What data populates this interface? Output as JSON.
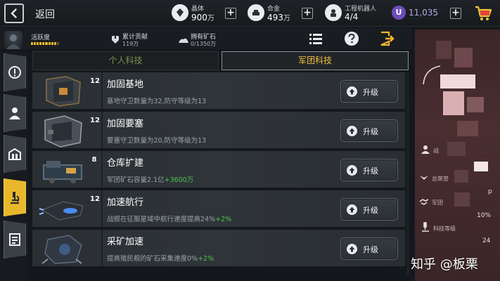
{
  "header": {
    "back_label": "返回",
    "resources": [
      {
        "icon": "crystal-icon",
        "label": "晶体",
        "value": "900",
        "unit": "万"
      },
      {
        "icon": "alloy-icon",
        "label": "合金",
        "value": "493",
        "unit": "万"
      },
      {
        "icon": "robot-icon",
        "label": "工程机器人",
        "value": "4/4",
        "unit": ""
      }
    ],
    "premium": {
      "icon_letter": "U",
      "value": "11,035"
    }
  },
  "stats": {
    "activity_label": "活跃度",
    "activity_filled": 9,
    "activity_segments": 10,
    "contribution_label": "累计贡献",
    "contribution_value": "119万",
    "ore_label": "拥有矿石",
    "ore_value": "0/1350万"
  },
  "tabs": {
    "personal": "个人科技",
    "legion": "军团科技",
    "active": "legion"
  },
  "upgrade_label": "升级",
  "techs": [
    {
      "level": "12",
      "name": "加固基地",
      "desc": "基地守卫数量为32,防守等级为13",
      "bonus": ""
    },
    {
      "level": "12",
      "name": "加固要塞",
      "desc": "要塞守卫数量为20,防守等级为13",
      "bonus": ""
    },
    {
      "level": "8",
      "name": "仓库扩建",
      "desc": "军团矿石容量2.1亿",
      "bonus": "+3600万"
    },
    {
      "level": "12",
      "name": "加速航行",
      "desc": "战舰在征服星域中航行速度提高24%",
      "bonus": "+2%"
    },
    {
      "level": "",
      "name": "采矿加速",
      "desc": "提高殖民舰的矿石采集速度0%",
      "bonus": "+2%"
    }
  ],
  "side_panel": {
    "labels": [
      "战",
      "总荣誉",
      "军团",
      "科技等级"
    ],
    "values": [
      "p",
      "10%",
      "24"
    ]
  },
  "watermark": "知乎 @板栗",
  "colors": {
    "accent": "#e9b82a",
    "active_tab_text": "#f0c23c",
    "bonus": "#4fc24f",
    "premium": "#6c4db8"
  }
}
